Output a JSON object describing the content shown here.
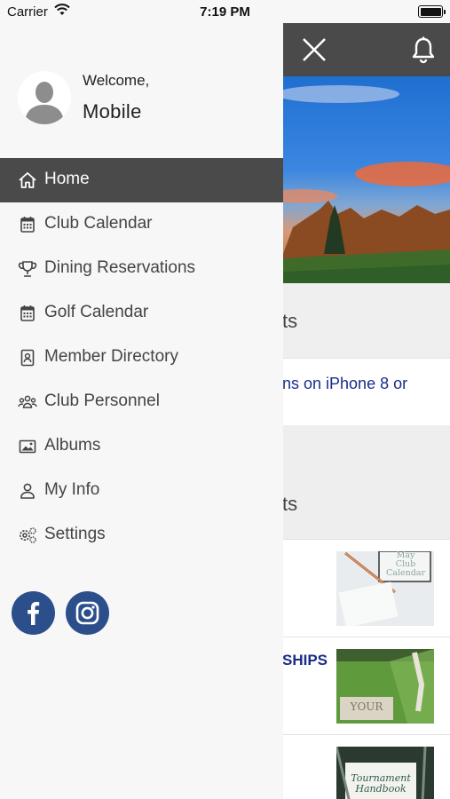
{
  "status_bar": {
    "carrier": "Carrier",
    "time": "7:19 PM"
  },
  "drawer": {
    "welcome": "Welcome,",
    "username": "Mobile",
    "menu": [
      {
        "label": "Home",
        "icon": "home-icon",
        "active": true
      },
      {
        "label": "Club Calendar",
        "icon": "calendar-icon",
        "active": false
      },
      {
        "label": "Dining Reservations",
        "icon": "trophy-icon",
        "active": false
      },
      {
        "label": "Golf Calendar",
        "icon": "calendar-icon",
        "active": false
      },
      {
        "label": "Member Directory",
        "icon": "contact-book-icon",
        "active": false
      },
      {
        "label": "Club Personnel",
        "icon": "group-icon",
        "active": false
      },
      {
        "label": "Albums",
        "icon": "image-icon",
        "active": false
      },
      {
        "label": "My Info",
        "icon": "user-icon",
        "active": false
      },
      {
        "label": "Settings",
        "icon": "gears-icon",
        "active": false
      }
    ],
    "social": [
      {
        "name": "facebook",
        "icon": "facebook-icon"
      },
      {
        "name": "instagram",
        "icon": "instagram-icon"
      }
    ]
  },
  "background": {
    "section1_title_fragment": "ts",
    "link_line1_fragment": "ns on iPhone 8 or",
    "section2_title_fragment": "ts",
    "news": [
      {
        "headline_fragment": "",
        "thumb_text": [
          "May",
          "Club",
          "Calendar"
        ]
      },
      {
        "headline_fragment": "SHIPS",
        "thumb_text": [
          "YOUR"
        ]
      },
      {
        "headline_fragment": "",
        "thumb_text": [
          "Tournament",
          "Handbook"
        ]
      }
    ]
  },
  "colors": {
    "header": "#4a4a4a",
    "drawer_bg": "#f7f7f7",
    "active_item": "#4a4a4a",
    "link": "#1a2c8a",
    "social": "#2c4f8c"
  }
}
